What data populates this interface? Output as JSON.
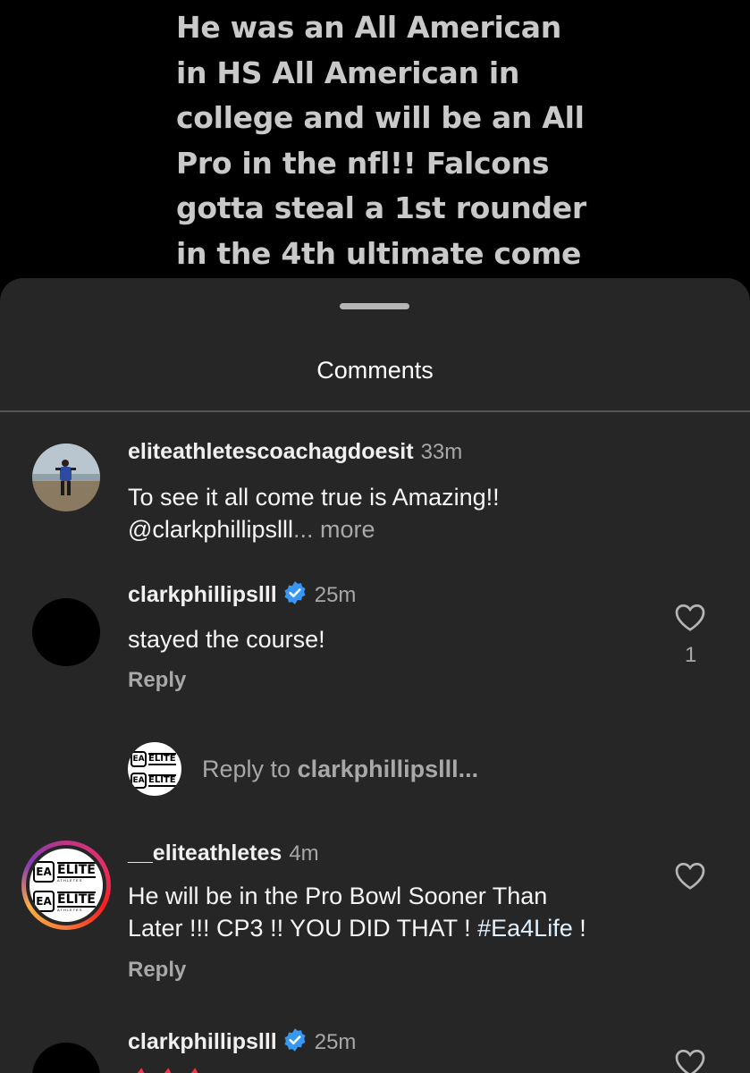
{
  "story": {
    "lines": [
      "He was an All American",
      "in HS All American in",
      "college and will be an All",
      "Pro in the nfl!! Falcons",
      "gotta steal a 1st rounder",
      "in the 4th ultimate come"
    ]
  },
  "sheet": {
    "title": "Comments"
  },
  "comments": [
    {
      "username": "eliteathletescoachagdoesit",
      "time": "33m",
      "text": "To see it all come true is Amazing!!",
      "text2": "@clarkphillipslll",
      "more": "... more"
    },
    {
      "username": "clarkphillipslll",
      "time": "25m",
      "text": "stayed the course!",
      "reply": "Reply",
      "likes": "1"
    },
    {
      "username": "__eliteathletes",
      "time": "4m",
      "text_line1": "He will be in the Pro Bowl Sooner Than",
      "text_line2": "Later !!! CP3 !! YOU DID THAT ! ",
      "hashtag": "#Ea4Life",
      "text_tail": " !",
      "reply": "Reply"
    },
    {
      "username": "clarkphillipslll",
      "time": "25m"
    }
  ],
  "reply_to": {
    "prefix": "Reply to ",
    "user": "clarkphillipslll..."
  },
  "logo": {
    "mark": "EA",
    "word": "ELITE",
    "sub": "ATHLETES"
  },
  "colors": {
    "sheet": "#262626",
    "verified": "#3897f0",
    "muted": "#a8a8a8"
  },
  "icons": [
    "heart-icon",
    "verified-icon"
  ]
}
